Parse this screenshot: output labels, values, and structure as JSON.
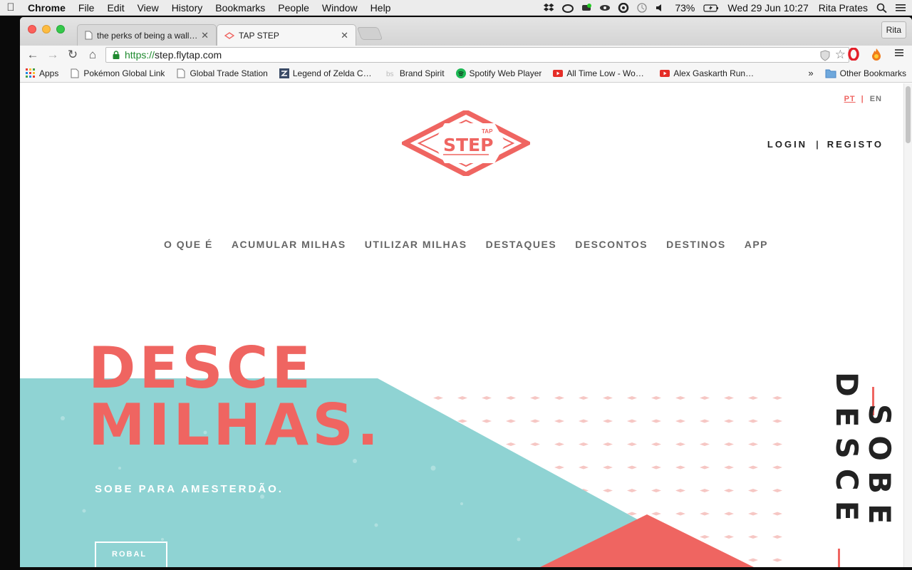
{
  "menubar": {
    "app": "Chrome",
    "items": [
      "File",
      "Edit",
      "View",
      "History",
      "Bookmarks",
      "People",
      "Window",
      "Help"
    ],
    "battery": "73%",
    "datetime": "Wed 29 Jun  10:27",
    "user": "Rita Prates"
  },
  "tabs": [
    {
      "title": "the perks of being a wallflower",
      "active": false
    },
    {
      "title": "TAP STEP",
      "active": true
    }
  ],
  "profile_button": "Rita",
  "address": {
    "scheme": "https://",
    "host": "step.flytap.com"
  },
  "bookmarks": [
    {
      "label": "Apps",
      "icon": "apps-grid-icon"
    },
    {
      "label": "Pokémon Global Link",
      "icon": "page-icon"
    },
    {
      "label": "Global Trade Station",
      "icon": "page-icon"
    },
    {
      "label": "Legend of Zelda Com",
      "icon": "zelda-icon"
    },
    {
      "label": "Brand Spirit",
      "icon": "be-icon"
    },
    {
      "label": "Spotify Web Player",
      "icon": "spotify-icon"
    },
    {
      "label": "All Time Low - Wonders",
      "icon": "youtube-icon"
    },
    {
      "label": "Alex Gaskarth Running",
      "icon": "youtube-icon"
    }
  ],
  "bookmarks_more": "»",
  "other_bookmarks": "Other Bookmarks",
  "site": {
    "lang_pt": "PT",
    "lang_sep": "|",
    "lang_en": "EN",
    "logo_small": "TAP",
    "logo_main": "STEP",
    "login": "LOGIN",
    "auth_sep": "|",
    "register": "REGISTO",
    "nav": [
      "O QUE É",
      "ACUMULAR MILHAS",
      "UTILIZAR MILHAS",
      "DESTAQUES",
      "DESCONTOS",
      "DESTINOS",
      "APP"
    ],
    "hero_line1": "DESCE",
    "hero_line2": "MILHAS.",
    "hero_sub": "SOBE PARA AMESTERDÃO.",
    "hero_button": "ROBAL",
    "vertical_left": "DESCE",
    "vertical_right": "SOBE"
  },
  "colors": {
    "brand": "#ef6561",
    "teal": "#8fd3d3",
    "dots": "#f6c7c4"
  }
}
